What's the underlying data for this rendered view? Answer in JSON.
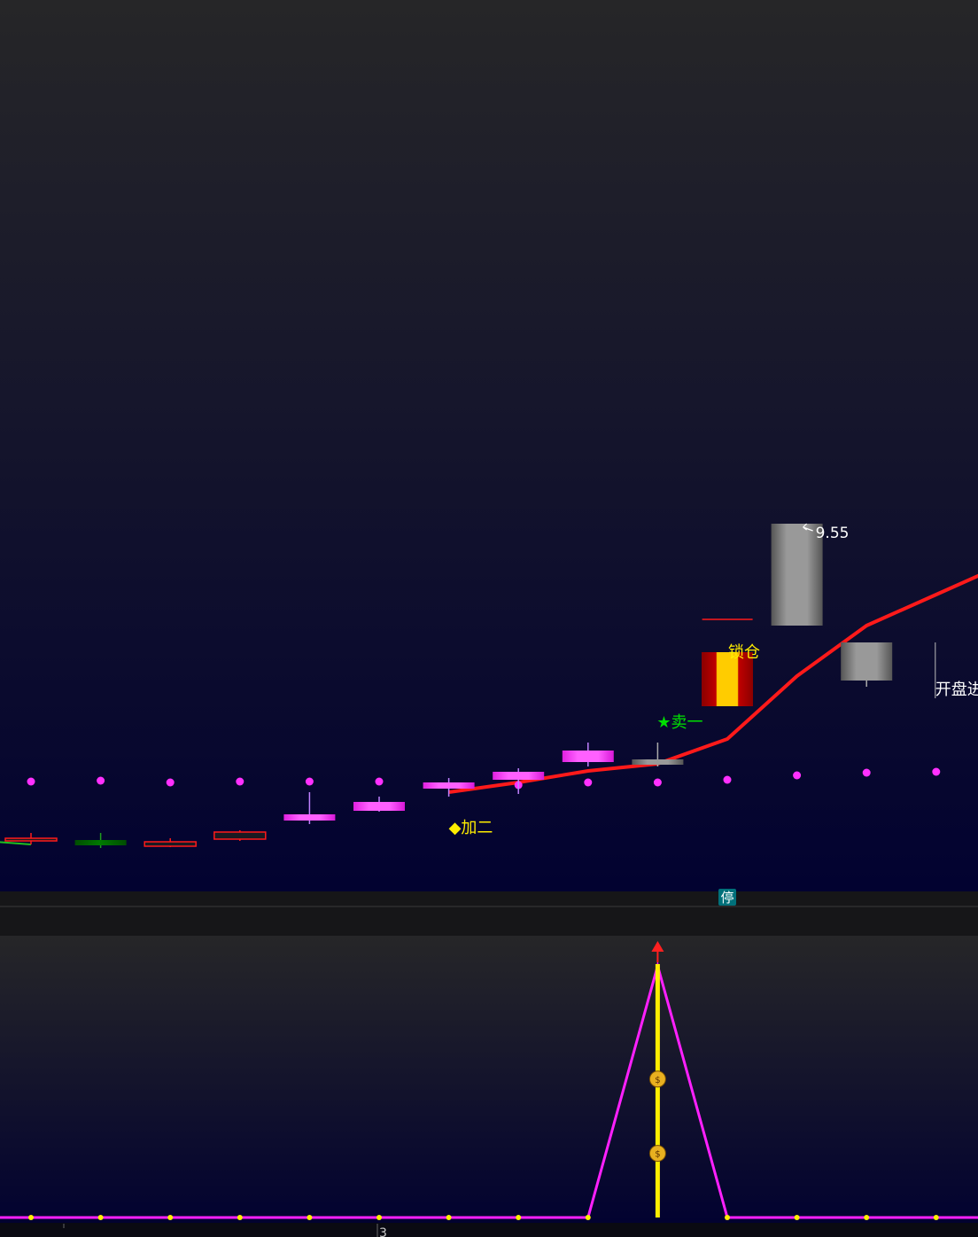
{
  "colors": {
    "main_top": "#262628",
    "main_bottom": "#020230",
    "separator": "#161618",
    "up_candle": "#ff40ff",
    "down_candle": "#006400",
    "hollow_red": "#ff1a1a",
    "gray_candle": "#8c8c8c",
    "limit_up_candle": "#ffcc00",
    "limit_up_edge": "#b00000",
    "ma_line": "#ff1a1a",
    "dots": "#ff30ff",
    "signal_yellow": "#ffee00",
    "signal_green": "#00e000",
    "text_white": "#ffffff",
    "ind_line": "#ff20ff",
    "ind_bar": "#ffee00",
    "ind_arrow": "#ff2020",
    "badge_bg": "#00707a"
  },
  "chart_data": [
    {
      "type": "candlestick",
      "title": "",
      "price_label": "9.55",
      "candles": [
        {
          "open": 5.97,
          "close": 6.0,
          "high": 6.06,
          "low": 5.93,
          "style": "hollow-red"
        },
        {
          "open": 5.98,
          "close": 5.92,
          "high": 6.06,
          "low": 5.89,
          "style": "green"
        },
        {
          "open": 5.91,
          "close": 5.96,
          "high": 6.0,
          "low": 5.9,
          "style": "hollow-red"
        },
        {
          "open": 5.99,
          "close": 6.07,
          "high": 6.09,
          "low": 5.97,
          "style": "hollow-red"
        },
        {
          "open": 6.2,
          "close": 6.27,
          "high": 6.52,
          "low": 6.16,
          "style": "magenta"
        },
        {
          "open": 6.31,
          "close": 6.41,
          "high": 6.47,
          "low": 6.3,
          "style": "magenta"
        },
        {
          "open": 6.56,
          "close": 6.63,
          "high": 6.68,
          "low": 6.47,
          "style": "magenta"
        },
        {
          "open": 6.66,
          "close": 6.75,
          "high": 6.79,
          "low": 6.5,
          "style": "magenta"
        },
        {
          "open": 6.86,
          "close": 6.99,
          "high": 7.08,
          "low": 6.81,
          "style": "magenta"
        },
        {
          "open": 6.83,
          "close": 6.89,
          "high": 7.08,
          "low": 6.81,
          "style": "gray"
        },
        {
          "open": 7.49,
          "close": 8.1,
          "high": 8.1,
          "low": 7.49,
          "style": "limit-up"
        },
        {
          "open": 9.55,
          "close": 8.4,
          "high": 9.55,
          "low": 8.4,
          "style": "gray"
        },
        {
          "open": 8.21,
          "close": 7.78,
          "high": 8.21,
          "low": 7.71,
          "style": "gray"
        }
      ],
      "ma_line": [
        null,
        null,
        null,
        null,
        null,
        null,
        6.52,
        6.63,
        6.76,
        6.84,
        7.12,
        7.83,
        8.4,
        8.75,
        9.1
      ],
      "dots": [
        6.64,
        6.65,
        6.63,
        6.64,
        6.64,
        6.64,
        null,
        6.6,
        6.63,
        6.63,
        6.66,
        6.71,
        6.74,
        6.75
      ],
      "annotations": [
        {
          "index": 6,
          "text": "◆加二",
          "color": "yellow"
        },
        {
          "index": 9,
          "text": "★卖一",
          "color": "green"
        },
        {
          "index": 10,
          "text": "锁仓",
          "color": "yellow"
        },
        {
          "index": 13,
          "text": "开盘进",
          "color": "white"
        }
      ],
      "badge": {
        "index": 10,
        "text": "停"
      }
    },
    {
      "type": "line",
      "title": "",
      "values": [
        0,
        0,
        0,
        0,
        0,
        0,
        0,
        0,
        0,
        1,
        0,
        0,
        0,
        0
      ],
      "bar_index": 9,
      "xtick": "3"
    }
  ]
}
